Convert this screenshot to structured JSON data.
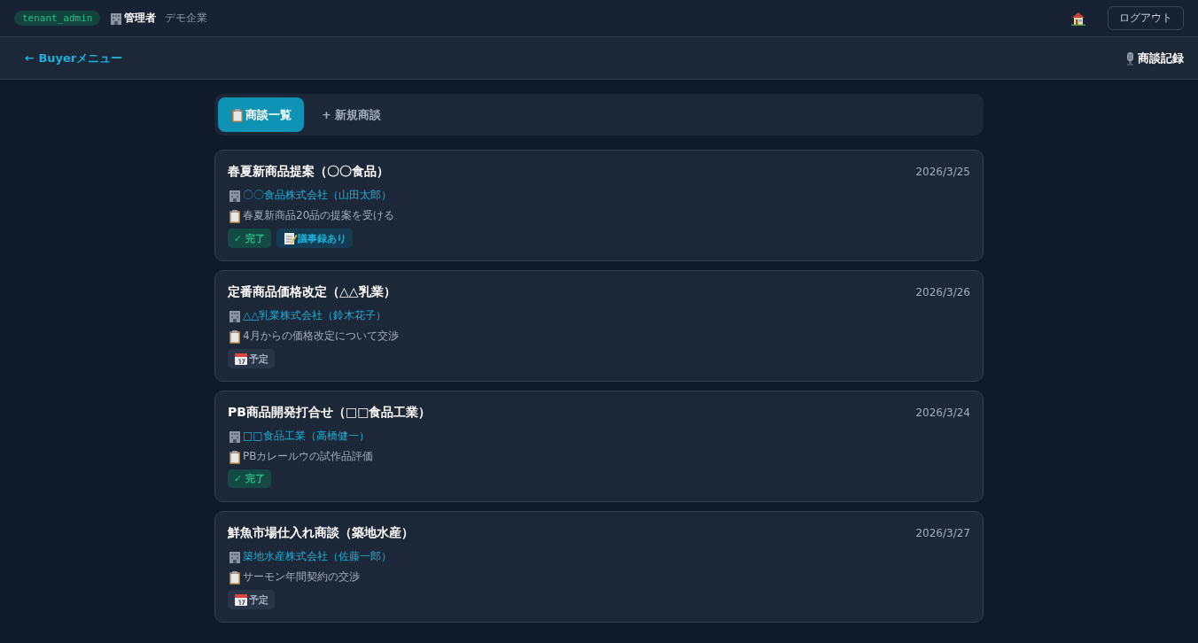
{
  "topbar": {
    "role_badge": "tenant_admin",
    "user": "管理者",
    "company": "デモ企業",
    "logout": "ログアウト"
  },
  "navbar": {
    "back_link": "← Buyerメニュー",
    "title": "商談記録"
  },
  "tabs": [
    {
      "label": "商談一覧",
      "kind": "list",
      "selected": true
    },
    {
      "label": "+ 新規商談",
      "kind": "new",
      "selected": false
    }
  ],
  "meetings": [
    {
      "title": "春夏新商品提案（〇〇食品）",
      "date": "2026/3/25",
      "supplier": "〇〇食品株式会社（山田太郎）",
      "note": "春夏新商品20品の提案を受ける",
      "tags": [
        {
          "kind": "done",
          "label": "✓ 完了"
        },
        {
          "kind": "minutes",
          "label": "議事録あり"
        }
      ]
    },
    {
      "title": "定番商品価格改定（△△乳業）",
      "date": "2026/3/26",
      "supplier": "△△乳業株式会社（鈴木花子）",
      "note": "4月からの価格改定について交渉",
      "tags": [
        {
          "kind": "scheduled",
          "label": "予定"
        }
      ]
    },
    {
      "title": "PB商品開発打合せ（□□食品工業）",
      "date": "2026/3/24",
      "supplier": "□□食品工業（高橋健一）",
      "note": "PBカレールウの試作品評価",
      "tags": [
        {
          "kind": "done",
          "label": "✓ 完了"
        }
      ]
    },
    {
      "title": "鮮魚市場仕入れ商談（築地水産）",
      "date": "2026/3/27",
      "supplier": "築地水産株式会社（佐藤一郎）",
      "note": "サーモン年間契約の交渉",
      "tags": [
        {
          "kind": "scheduled",
          "label": "予定"
        }
      ]
    }
  ]
}
